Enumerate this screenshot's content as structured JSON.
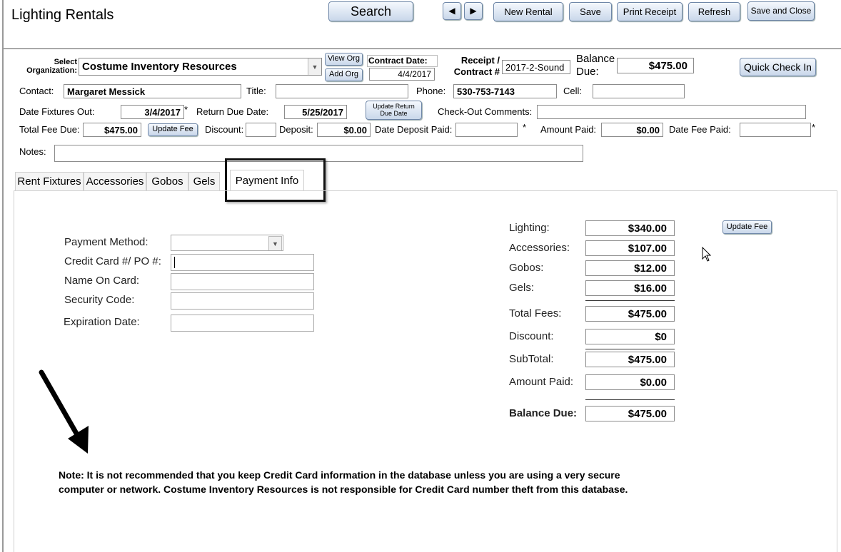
{
  "window": {
    "title": "Lighting Rentals"
  },
  "toolbar": {
    "search": "Search",
    "new_rental": "New Rental",
    "save": "Save",
    "print_receipt": "Print Receipt",
    "refresh": "Refresh",
    "save_and_close": "Save and Close"
  },
  "header": {
    "select_org_label": "Select Organization:",
    "organization": "Costume Inventory Resources",
    "view_org": "View Org",
    "add_org": "Add Org",
    "contract_date_label": "Contract Date:",
    "contract_date": "4/4/2017",
    "receipt_label": "Receipt / Contract #",
    "receipt_value": "2017-2-Sound",
    "balance_due_label": "Balance Due:",
    "balance_due": "$475.00",
    "quick_check_in": "Quick Check In",
    "contact_label": "Contact:",
    "contact": "Margaret Messick",
    "title_label": "Title:",
    "title": "",
    "phone_label": "Phone:",
    "phone": "530-753-7143",
    "cell_label": "Cell:",
    "cell": "",
    "date_out_label": "Date Fixtures Out:",
    "date_out": "3/4/2017",
    "asterisk": "*",
    "return_due_label": "Return Due Date:",
    "return_due": "5/25/2017",
    "update_return_due": "Update Return Due Date",
    "checkout_comments_label": "Check-Out Comments:",
    "checkout_comments": "",
    "total_fee_label": "Total Fee Due:",
    "total_fee": "$475.00",
    "update_fee": "Update Fee",
    "discount_label": "Discount:",
    "discount": "",
    "deposit_label": "Deposit:",
    "deposit": "$0.00",
    "date_deposit_label": "Date Deposit Paid:",
    "date_deposit": "",
    "amount_paid_label": "Amount Paid:",
    "amount_paid": "$0.00",
    "date_fee_label": "Date Fee Paid:",
    "date_fee": "",
    "notes_label": "Notes:",
    "notes": ""
  },
  "tabs": [
    {
      "label": "Rent Fixtures"
    },
    {
      "label": "Accessories"
    },
    {
      "label": "Gobos"
    },
    {
      "label": "Gels"
    },
    {
      "label": "Payment Info"
    }
  ],
  "payment": {
    "method_label": "Payment Method:",
    "method": "",
    "card_label": "Credit Card #/ PO #:",
    "card": "",
    "name_label": "Name On Card:",
    "name": "",
    "security_label": "Security Code:",
    "security": "",
    "expiration_label": "Expiration Date:",
    "expiration": ""
  },
  "fees": {
    "lighting_label": "Lighting:",
    "lighting": "$340.00",
    "accessories_label": "Accessories:",
    "accessories": "$107.00",
    "gobos_label": "Gobos:",
    "gobos": "$12.00",
    "gels_label": "Gels:",
    "gels": "$16.00",
    "total_label": "Total Fees:",
    "total": "$475.00",
    "discount_label": "Discount:",
    "discount": "$0",
    "subtotal_label": "SubTotal:",
    "subtotal": "$475.00",
    "paid_label": "Amount Paid:",
    "paid": "$0.00",
    "balance_label": "Balance Due:",
    "balance": "$475.00",
    "update_fee": "Update Fee"
  },
  "note": {
    "line1": "Note:  It is not recommended that you keep Credit Card information in the database unless you are using a very secure",
    "line2": "computer or network.  Costume Inventory Resources is not responsible for Credit Card number theft from this database."
  },
  "icons": {
    "prev": "arrow-left-icon",
    "next": "arrow-right-icon",
    "dropdown": "chevron-down-icon",
    "cursor": "mouse-pointer-icon",
    "annotation": "annotation-arrow-icon"
  },
  "colors": {
    "button_top": "#f4f8fd",
    "button_bottom": "#c9d7ea",
    "button_border": "#6f87a8"
  }
}
